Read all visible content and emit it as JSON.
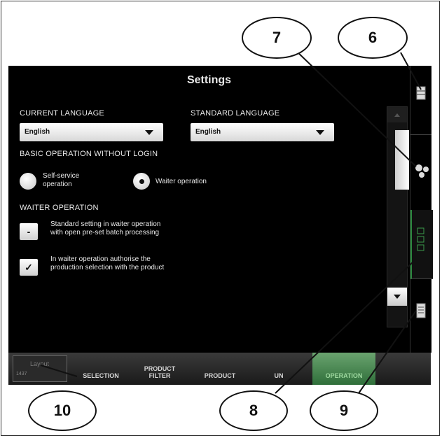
{
  "screen": {
    "title": "Settings",
    "current_language": {
      "label": "CURRENT LANGUAGE",
      "value": "English"
    },
    "standard_language": {
      "label": "STANDARD LANGUAGE",
      "value": "English"
    },
    "basic_operation": {
      "label": "BASIC OPERATION WITHOUT LOGIN",
      "options": [
        {
          "line1": "Self-service",
          "line2": "operation",
          "selected": false
        },
        {
          "line1": "Waiter operation",
          "line2": "",
          "selected": true
        }
      ]
    },
    "waiter_operation": {
      "label": "WAITER OPERATION",
      "items": [
        {
          "mark": "-",
          "line1": "Standard setting in waiter operation",
          "line2": "with open pre-set batch processing"
        },
        {
          "mark": "✓",
          "line1": "In waiter operation authorise the",
          "line2": "production selection with the product"
        }
      ]
    }
  },
  "tabs": {
    "layout": {
      "label": "Layout",
      "number": "1437"
    },
    "items": [
      {
        "line1": "",
        "line2": "SELECTION",
        "active": false
      },
      {
        "line1": "PRODUCT",
        "line2": "FILTER",
        "active": false
      },
      {
        "line1": "",
        "line2": "PRODUCT",
        "active": false
      },
      {
        "line1": "",
        "line2": "UN",
        "active": false
      },
      {
        "line1": "",
        "line2": "OPERATION",
        "active": true
      }
    ]
  },
  "callouts": [
    "7",
    "6",
    "10",
    "8",
    "9"
  ],
  "colors": {
    "screen_bg": "#000000",
    "active_tab": "#2f6f3a",
    "text": "#e8e8e8"
  }
}
